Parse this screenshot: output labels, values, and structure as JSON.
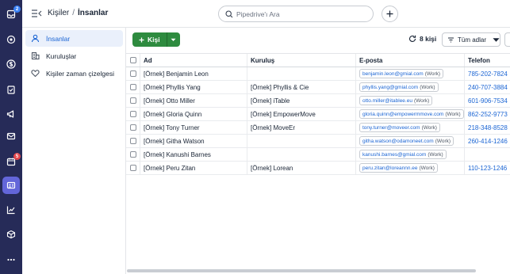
{
  "rail": {
    "badges": {
      "leads": "2",
      "activities": "5"
    }
  },
  "header": {
    "parent": "Kişiler",
    "separator": "/",
    "current": "İnsanlar",
    "search_placeholder": "Pipedrive'ı Ara"
  },
  "sidebar": {
    "items": [
      {
        "label": "İnsanlar"
      },
      {
        "label": "Kuruluşlar"
      },
      {
        "label": "Kişiler zaman çizelgesi"
      }
    ]
  },
  "toolbar": {
    "add_label": "Kişi",
    "count_label": "8 kişi",
    "filter_label": "Tüm adlar"
  },
  "table": {
    "columns": [
      "Ad",
      "Kuruluş",
      "E-posta",
      "Telefon"
    ],
    "rows": [
      {
        "name": "[Örnek] Benjamin Leon",
        "org": "",
        "email": "benjamin.leon@gmial.com",
        "email_label": "(Work)",
        "phone": "785-202-7824"
      },
      {
        "name": "[Örnek] Phyllis Yang",
        "org": "[Örnek] Phyllis & Cie",
        "email": "phyllis.yang@gmial.com",
        "email_label": "(Work)",
        "phone": "240-707-3884"
      },
      {
        "name": "[Örnek] Otto Miller",
        "org": "[Örnek] iTable",
        "email": "otto.miller@itablee.eu",
        "email_label": "(Work)",
        "phone": "601-906-7534"
      },
      {
        "name": "[Örnek] Gloria Quinn",
        "org": "[Örnek] EmpowerMove",
        "email": "gloria.quinn@empowermmove.com",
        "email_label": "(Work)",
        "phone": "862-252-9773"
      },
      {
        "name": "[Örnek] Tony Turner",
        "org": "[Örnek] MoveEr",
        "email": "tony.turner@moveer.com",
        "email_label": "(Work)",
        "phone": "218-348-8528"
      },
      {
        "name": "[Örnek] Githa Watson",
        "org": "",
        "email": "githa.watson@odamoneet.com",
        "email_label": "(Work)",
        "phone": "260-414-1246"
      },
      {
        "name": "[Örnek] Kanushi Barnes",
        "org": "",
        "email": "kanushi.barnes@gmial.com",
        "email_label": "(Work)",
        "phone": ""
      },
      {
        "name": "[Örnek] Peru Zitan",
        "org": "[Örnek] Lorean",
        "email": "peru.zitan@loreannn.ee",
        "email_label": "(Work)",
        "phone": "110-123-1246"
      }
    ]
  },
  "colors": {
    "rail_bg": "#262b58",
    "rail_active": "#6366d9",
    "primary_green": "#2e8b3f",
    "link_blue": "#1b65d4",
    "badge_blue": "#3b82f6",
    "badge_red": "#e5484d"
  }
}
